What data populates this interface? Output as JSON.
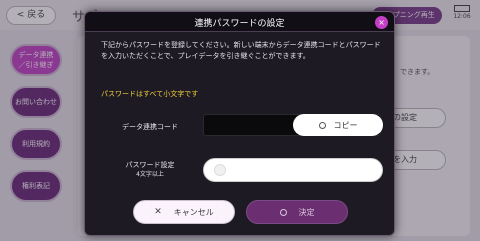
{
  "background": {
    "back_label": "< 戻る",
    "title": "サポートメニュー",
    "opening_label": "オープニング再生",
    "battery_time": "12:06",
    "sidebar": [
      {
        "label": "データ連携\n／引き継ぎ",
        "active": true
      },
      {
        "label": "お問い合わせ",
        "active": false
      },
      {
        "label": "利用規約",
        "active": false
      },
      {
        "label": "権利表記",
        "active": false
      }
    ],
    "peek_text": "できます。",
    "peek_button_1": "ドの設定",
    "peek_button_2": "ドを入力"
  },
  "dialog": {
    "title": "連携パスワードの設定",
    "close_label": "×",
    "description": "下記からパスワードを登録してください。新しい端末からデータ連携コードとパスワードを入力いただくことで、プレイデータを引き継ぐことができます。",
    "note": "パスワードはすべて小文字です",
    "code_label": "データ連携コード",
    "copy_label": "コピー",
    "password_label": "パスワード設定",
    "password_hint": "4文字以上",
    "cancel_label": "キャンセル",
    "confirm_label": "決定"
  },
  "colors": {
    "accent": "#c048c6",
    "dialog_bg": "#1e1a24",
    "note": "#f2d23a",
    "confirm": "#6b2f71"
  }
}
